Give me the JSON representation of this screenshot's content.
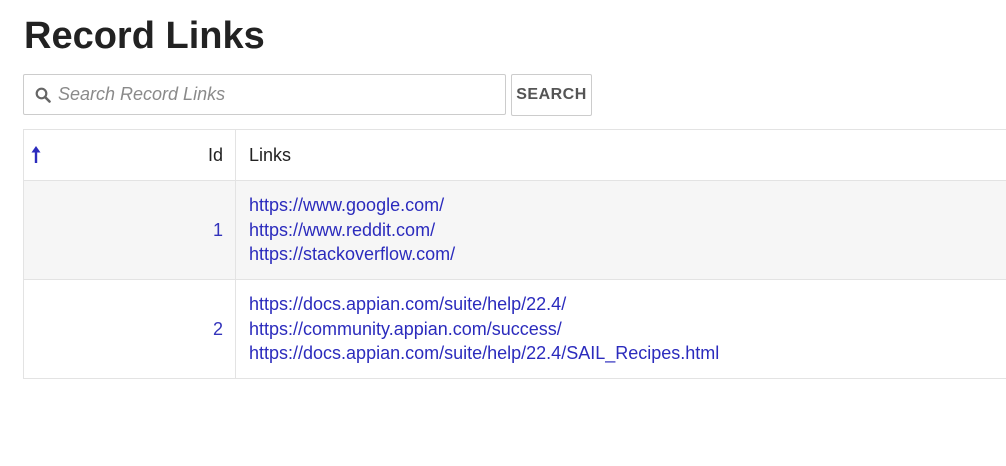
{
  "page": {
    "title": "Record Links"
  },
  "search": {
    "placeholder": "Search Record Links",
    "value": "",
    "button_label": "SEARCH",
    "icon": "search-icon"
  },
  "grid": {
    "sort_icon": "sort-ascending-arrow-icon",
    "columns": {
      "id": "Id",
      "links": "Links"
    },
    "rows": [
      {
        "id": "1",
        "links": [
          "https://www.google.com/",
          "https://www.reddit.com/",
          "https://stackoverflow.com/"
        ]
      },
      {
        "id": "2",
        "links": [
          "https://docs.appian.com/suite/help/22.4/",
          "https://community.appian.com/success/",
          "https://docs.appian.com/suite/help/22.4/SAIL_Recipes.html"
        ]
      }
    ]
  },
  "colors": {
    "link": "#2b2bbd",
    "sort_arrow": "#2b2bbd",
    "row_shade": "#f6f6f6",
    "border": "#e3e3e3"
  }
}
